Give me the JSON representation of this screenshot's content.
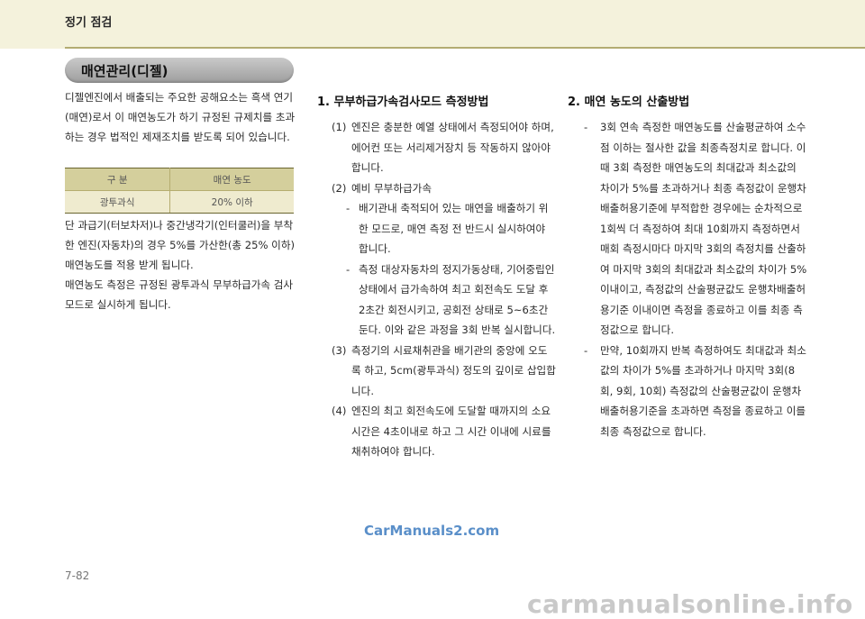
{
  "header": {
    "title": "정기 점검"
  },
  "section": {
    "title": "매연관리(디젤)"
  },
  "left": {
    "intro": "디젤엔진에서 배출되는 주요한 공해요소는 흑색 연기(매연)로서 이 매연농도가 하기 규정된 규제치를 초과하는 경우 법적인 제재조치를 받도록 되어 있습니다.",
    "table": {
      "headers": [
        "구 분",
        "매연 농도"
      ],
      "rows": [
        [
          "광투과식",
          "20% 이하"
        ]
      ]
    },
    "note1": "단 과급기(터보차저)나 중간냉각기(인터쿨러)을 부착한 엔진(자동차)의 경우 5%를 가산한(총 25% 이하) 매연농도를 적용 받게 됩니다.",
    "note2": "매연농도 측정은 규정된 광투과식 무부하급가속 검사모드로 실시하게 됩니다."
  },
  "mid": {
    "title": "1. 무부하급가속검사모드 측정방법",
    "items": [
      {
        "marker": "(1)",
        "text": "엔진은 충분한 예열 상태에서 측정되어야 하며, 에어컨 또는 서리제거장치 등 작동하지 않아야 합니다."
      },
      {
        "marker": "(2)",
        "text": "예비 무부하급가속"
      },
      {
        "marker": "-",
        "text": "배기관내 축적되어 있는 매연을 배출하기 위한 모드로, 매연 측정 전 반드시 실시하여야 합니다."
      },
      {
        "marker": "-",
        "text": "측정 대상자동차의 정지가동상태, 기어중립인 상태에서 급가속하여 최고 회전속도 도달 후 2초간 회전시키고, 공회전 상태로 5~6초간 둔다. 이와 같은 과정을 3회 반복 실시합니다."
      },
      {
        "marker": "(3)",
        "text": "측정기의 시료채취관을 배기관의 중앙에 오도록 하고, 5cm(광투과식) 정도의 깊이로 삽입합니다."
      },
      {
        "marker": "(4)",
        "text": "엔진의 최고 회전속도에 도달할 때까지의 소요시간은 4초이내로 하고 그 시간 이내에 시료를 채취하여야 합니다."
      }
    ]
  },
  "right": {
    "title": "2. 매연 농도의 산출방법",
    "items": [
      {
        "marker": "-",
        "text": "3회 연속 측정한 매연농도를 산술평균하여 소수점 이하는 절사한 값을 최종측정치로 합니다. 이때 3회 측정한 매연농도의 최대값과 최소값의 차이가 5%를 초과하거나 최종 측정값이 운행차 배출허용기준에 부적합한 경우에는 순차적으로 1회씩 더 측정하여 최대 10회까지 측정하면서 매회 측정시마다 마지막 3회의 측정치를 산출하여 마지막 3회의 최대값과 최소값의 차이가 5% 이내이고, 측정값의 산술평균값도 운행차배출허용기준 이내이면 측정을 종료하고 이를 최종 측정값으로 합니다."
      },
      {
        "marker": "-",
        "text": "만약, 10회까지 반복 측정하여도 최대값과 최소값의 차이가 5%를 초과하거나 마지막 3회(8회, 9회, 10회) 측정값의 산술평균값이 운행차배출허용기준을 초과하면 측정을 종료하고 이를 최종 측정값으로 합니다."
      }
    ]
  },
  "watermark": "CarManuals2.com",
  "page_number": "7-82",
  "footer_watermark": "carmanualsonline.info"
}
